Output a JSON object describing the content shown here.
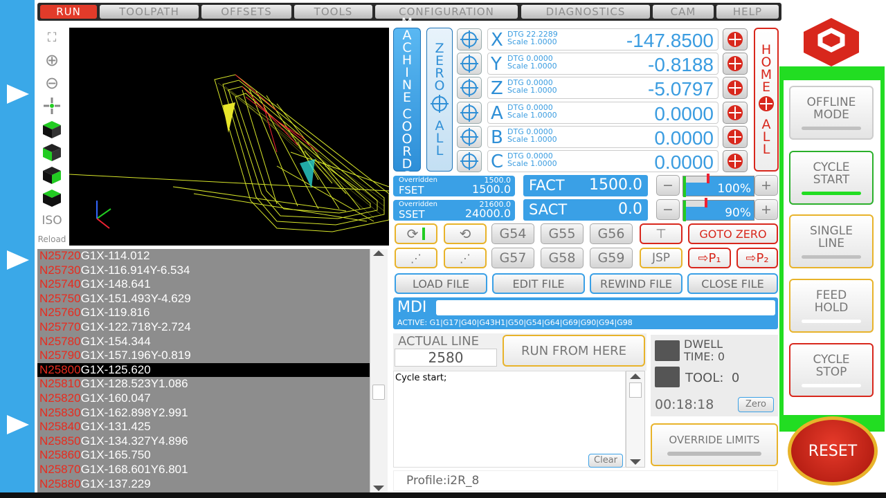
{
  "menu": {
    "items": [
      "RUN",
      "TOOLPATH",
      "OFFSETS",
      "TOOLS",
      "CONFIGURATION",
      "DIAGNOSTICS",
      "CAM",
      "HELP"
    ],
    "active": "RUN"
  },
  "viewport": {
    "iso_label": "ISO",
    "reload_label": "Reload"
  },
  "gcode": {
    "lines": [
      {
        "n": "N25720",
        "code": "G1X-114.012"
      },
      {
        "n": "N25730",
        "code": "G1X-116.914Y-6.534"
      },
      {
        "n": "N25740",
        "code": "G1X-148.641"
      },
      {
        "n": "N25750",
        "code": "G1X-151.493Y-4.629"
      },
      {
        "n": "N25760",
        "code": "G1X-119.816"
      },
      {
        "n": "N25770",
        "code": "G1X-122.718Y-2.724"
      },
      {
        "n": "N25780",
        "code": "G1X-154.344"
      },
      {
        "n": "N25790",
        "code": "G1X-157.196Y-0.819"
      },
      {
        "n": "N25800",
        "code": "G1X-125.620"
      },
      {
        "n": "N25810",
        "code": "G1X-128.523Y1.086"
      },
      {
        "n": "N25820",
        "code": "G1X-160.047"
      },
      {
        "n": "N25830",
        "code": "G1X-162.898Y2.991"
      },
      {
        "n": "N25840",
        "code": "G1X-131.425"
      },
      {
        "n": "N25850",
        "code": "G1X-134.327Y4.896"
      },
      {
        "n": "N25860",
        "code": "G1X-165.750"
      },
      {
        "n": "N25870",
        "code": "G1X-168.601Y6.801"
      },
      {
        "n": "N25880",
        "code": "G1X-137.229"
      }
    ],
    "current_index": 8
  },
  "coords": {
    "machine_coords_label": "MACHINE COORDS",
    "zero_all_label": "ZERO ALL",
    "home_all_label": "HOME ALL",
    "axes": [
      {
        "letter": "X",
        "dtg": "DTG 22.2289",
        "scale": "Scale 1.0000",
        "value": "-147.8500"
      },
      {
        "letter": "Y",
        "dtg": "DTG 0.0000",
        "scale": "Scale 1.0000",
        "value": "-0.8188"
      },
      {
        "letter": "Z",
        "dtg": "DTG 0.0000",
        "scale": "Scale 1.0000",
        "value": "-5.0797"
      },
      {
        "letter": "A",
        "dtg": "DTG 0.0000",
        "scale": "Scale 1.0000",
        "value": "0.0000"
      },
      {
        "letter": "B",
        "dtg": "DTG 0.0000",
        "scale": "Scale 1.0000",
        "value": "0.0000"
      },
      {
        "letter": "C",
        "dtg": "DTG 0.0000",
        "scale": "Scale 1.0000",
        "value": "0.0000"
      }
    ]
  },
  "feed": {
    "overridden_label": "Overridden",
    "overridden_value": "1500.0",
    "set_label": "FSET",
    "set_value": "1500.0",
    "act_label": "FACT",
    "act_value": "1500.0",
    "percent": "100%",
    "level": 0.33
  },
  "spindle": {
    "overridden_label": "Overridden",
    "overridden_value": "21600.0",
    "set_label": "SSET",
    "set_value": "24000.0",
    "act_label": "SACT",
    "act_value": "0.0",
    "percent": "90%",
    "level": 0.3
  },
  "buttons": {
    "g54": "G54",
    "g55": "G55",
    "g56": "G56",
    "g57": "G57",
    "g58": "G58",
    "g59": "G59",
    "goto_zero": "GOTO ZERO",
    "jsp": "JSP",
    "p1": "⇨P₁",
    "p2": "⇨P₂",
    "load_file": "LOAD FILE",
    "edit_file": "EDIT FILE",
    "rewind_file": "REWIND FILE",
    "close_file": "CLOSE FILE",
    "run_from_here": "RUN FROM HERE",
    "zero": "Zero",
    "clear": "Clear",
    "override_limits": "OVERRIDE LIMITS",
    "offline_mode": "OFFLINE MODE",
    "cycle_start": "CYCLE START",
    "single_line": "SINGLE LINE",
    "feed_hold": "FEED HOLD",
    "cycle_stop": "CYCLE STOP",
    "reset": "RESET"
  },
  "mdi": {
    "label": "MDI",
    "value": "",
    "active_codes": "ACTIVE: G1|G17|G40|G43H1|G50|G54|G64|G69|G90|G94|G98"
  },
  "status": {
    "actual_line_label": "ACTUAL LINE",
    "actual_line_value": "2580",
    "dwell_label": "DWELL",
    "time_label": "TIME:",
    "time_value": "0",
    "tool_label": "TOOL:",
    "tool_value": "0",
    "elapsed": "00:18:18",
    "console_text": "Cycle start;",
    "profile": "Profile:i2R_8"
  },
  "colors": {
    "accent": "#3aa0e6",
    "danger": "#d8271c",
    "active_green": "#22dd22",
    "caution": "#e8b32a"
  }
}
